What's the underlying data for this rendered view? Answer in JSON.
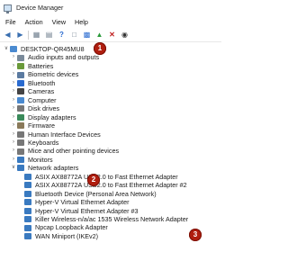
{
  "window": {
    "title": "Device Manager"
  },
  "menu": [
    "File",
    "Action",
    "View",
    "Help"
  ],
  "toolbar": {
    "icons": [
      "back-icon",
      "forward-icon",
      "properties-icon",
      "help-icon",
      "scan-icon",
      "monitor-icon",
      "update-driver-icon",
      "uninstall-icon",
      "disable-icon"
    ]
  },
  "tree": {
    "root": "DESKTOP-QR45MU8",
    "categories": [
      {
        "label": "Audio inputs and outputs",
        "icon": "audio-icon",
        "color": "#7a8a9a"
      },
      {
        "label": "Batteries",
        "icon": "battery-icon",
        "color": "#6a9a3a"
      },
      {
        "label": "Biometric devices",
        "icon": "biometric-icon",
        "color": "#5a7aa0"
      },
      {
        "label": "Bluetooth",
        "icon": "bluetooth-icon",
        "color": "#2a6bd0"
      },
      {
        "label": "Cameras",
        "icon": "camera-icon",
        "color": "#444444"
      },
      {
        "label": "Computer",
        "icon": "computer-icon",
        "color": "#4a8ad0"
      },
      {
        "label": "Disk drives",
        "icon": "disk-icon",
        "color": "#777777"
      },
      {
        "label": "Display adapters",
        "icon": "display-icon",
        "color": "#3a8a5a"
      },
      {
        "label": "Firmware",
        "icon": "firmware-icon",
        "color": "#8a7a5a"
      },
      {
        "label": "Human Interface Devices",
        "icon": "hid-icon",
        "color": "#777777"
      },
      {
        "label": "Keyboards",
        "icon": "keyboard-icon",
        "color": "#777777"
      },
      {
        "label": "Mice and other pointing devices",
        "icon": "mouse-icon",
        "color": "#777777"
      },
      {
        "label": "Monitors",
        "icon": "monitor-icon",
        "color": "#3a7ac0"
      }
    ],
    "network": {
      "label": "Network adapters",
      "children": [
        "ASIX AX88772A USB2.0 to Fast Ethernet Adapter",
        "ASIX AX88772A USB2.0 to Fast Ethernet Adapter #2",
        "Bluetooth Device (Personal Area Network)",
        "Hyper-V Virtual Ethernet Adapter",
        "Hyper-V Virtual Ethernet Adapter #3",
        "Killer Wireless-n/a/ac 1535 Wireless Network Adapter",
        "Npcap Loopback Adapter",
        "WAN Miniport (IKEv2)"
      ]
    }
  },
  "badges": [
    "1",
    "2",
    "3"
  ],
  "colors": {
    "badge": "#b01e0f",
    "network_icon": "#3a7ac0"
  }
}
